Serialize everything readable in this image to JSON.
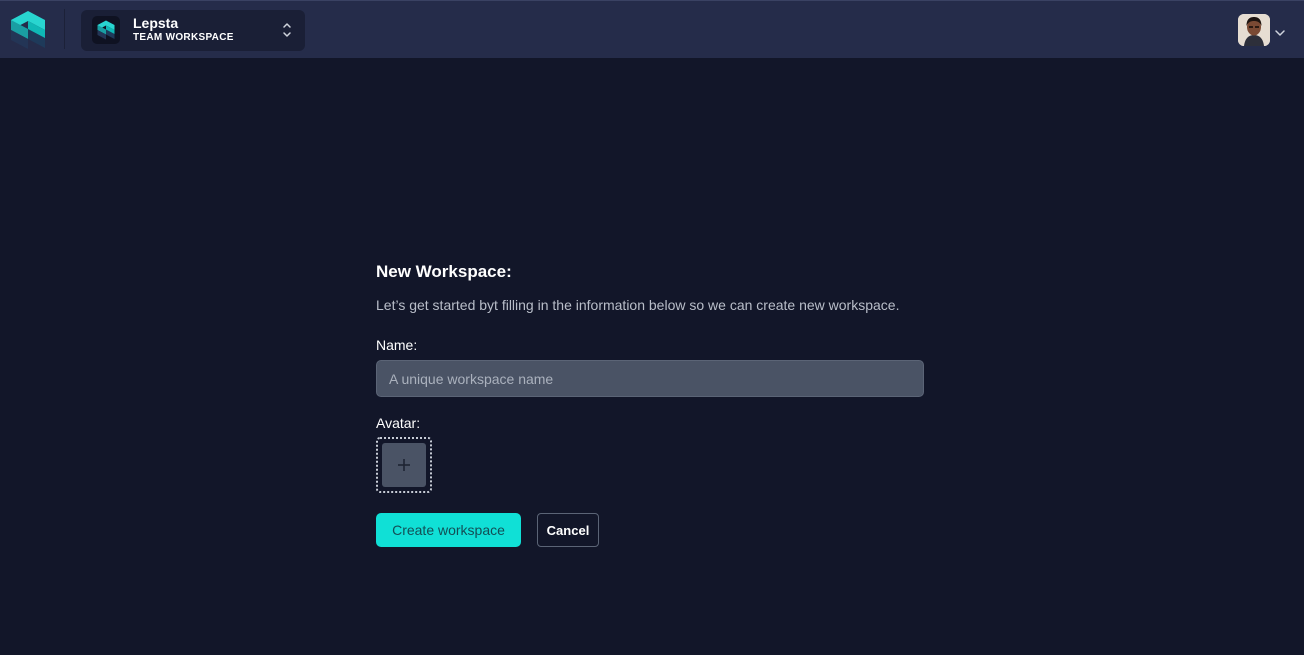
{
  "header": {
    "logo_icon": "app-logo-icon",
    "workspace": {
      "name": "Lepsta",
      "type": "TEAM WORKSPACE",
      "switch_icon": "chevron-up-down-icon"
    },
    "user_menu": {
      "avatar_icon": "user-avatar",
      "chevron_icon": "chevron-down-icon"
    }
  },
  "form": {
    "title": "New Workspace:",
    "subtitle": "Let’s get started byt filling in the information below so we can create new workspace.",
    "name_label": "Name:",
    "name_value": "",
    "name_placeholder": "A unique workspace name",
    "avatar_label": "Avatar:",
    "avatar_upload_icon": "plus-icon",
    "create_label": "Create workspace",
    "cancel_label": "Cancel"
  },
  "colors": {
    "background": "#121629",
    "header": "#252c4a",
    "accent": "#10e0d6",
    "input": "#4a5365"
  }
}
